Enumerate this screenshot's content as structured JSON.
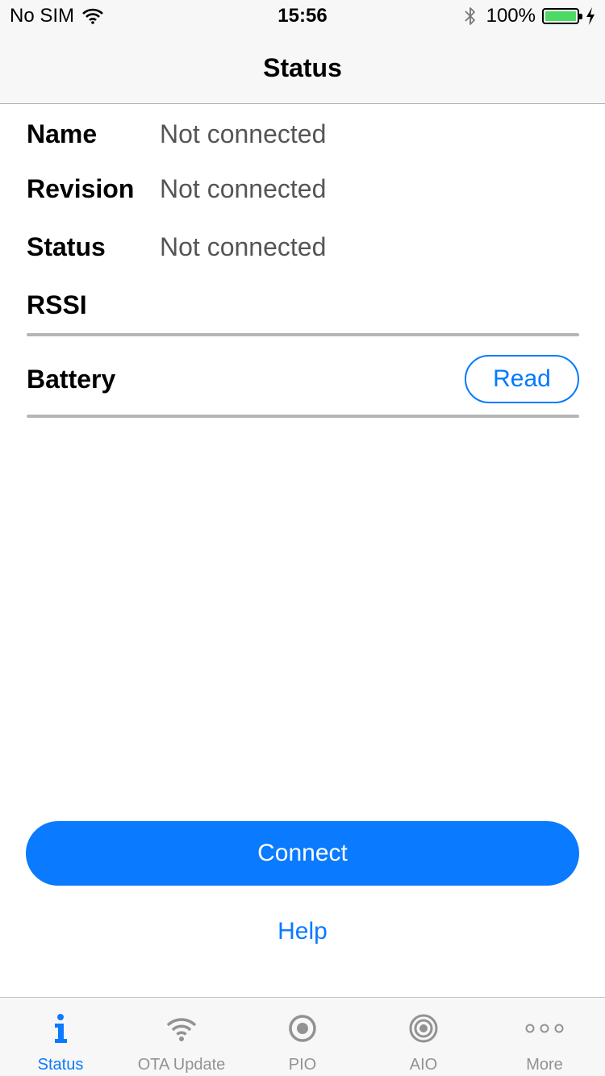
{
  "status_bar": {
    "carrier": "No SIM",
    "time": "15:56",
    "battery_percent": "100%",
    "battery_level": 1.0,
    "icons": [
      "wifi-icon",
      "bluetooth-icon",
      "battery-icon",
      "charging-icon"
    ]
  },
  "navbar": {
    "title": "Status"
  },
  "rows": [
    {
      "label": "Name",
      "value": "Not connected"
    },
    {
      "label": "Revision",
      "value": "Not connected"
    },
    {
      "label": "Status",
      "value": "Not connected"
    },
    {
      "label": "RSSI",
      "value": ""
    }
  ],
  "battery": {
    "label": "Battery",
    "read_label": "Read"
  },
  "actions": {
    "connect_label": "Connect",
    "help_label": "Help"
  },
  "tabbar": {
    "active_index": 0,
    "items": [
      {
        "label": "Status",
        "icon": "info-icon"
      },
      {
        "label": "OTA Update",
        "icon": "wifi-icon"
      },
      {
        "label": "PIO",
        "icon": "radio-icon"
      },
      {
        "label": "AIO",
        "icon": "target-icon"
      },
      {
        "label": "More",
        "icon": "more-icon"
      }
    ]
  },
  "colors": {
    "accent": "#0a7aff",
    "battery_fill": "#4cd964",
    "inactive_tab": "#929292"
  }
}
